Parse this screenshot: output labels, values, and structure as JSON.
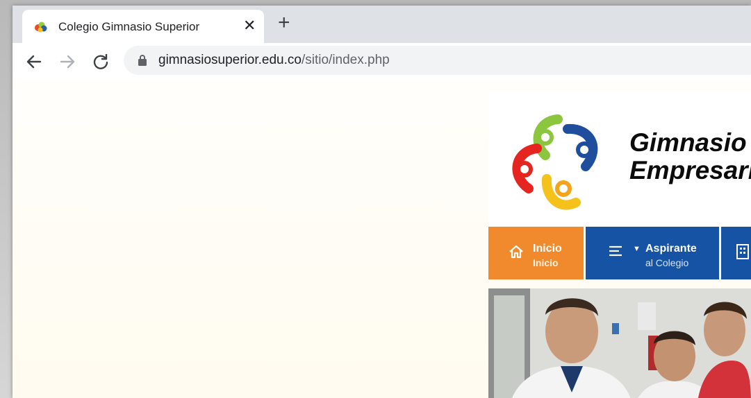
{
  "browser": {
    "tab": {
      "title": "Colegio Gimnasio Superior",
      "close_icon": "close-icon"
    },
    "new_tab_icon": "plus-icon",
    "address": {
      "host": "gimnasiosuperior.edu.co",
      "path": "/sitio/index.php"
    }
  },
  "site": {
    "name_line1": "Gimnasio",
    "name_line2": "Empresaria",
    "nav": [
      {
        "label": "Inicio",
        "sublabel": "Inicio",
        "icon": "home-icon",
        "color": "#f08a2c"
      },
      {
        "label": "Aspirante",
        "sublabel": "al Colegio",
        "icon": "menu-lines-icon",
        "color": "#1653a5"
      },
      {
        "icon": "building-icon",
        "color": "#1653a5"
      }
    ]
  }
}
